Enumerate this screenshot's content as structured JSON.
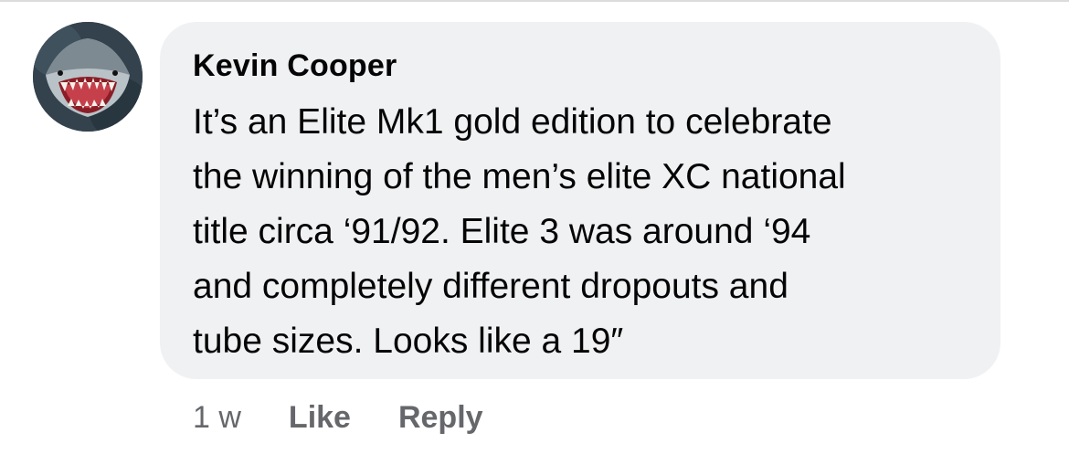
{
  "comment": {
    "author": "Kevin Cooper",
    "avatar_icon": "shark-avatar",
    "body_lines": [
      "It’s an Elite Mk1 gold edition to celebrate",
      "the winning of the men’s elite XC national",
      "title circa ‘91/92. Elite 3 was around ‘94",
      "and completely different dropouts and",
      "tube sizes. Looks like a 19″"
    ],
    "timestamp": "1 w",
    "like_label": "Like",
    "reply_label": "Reply"
  },
  "colors": {
    "bubble": "#f0f1f3",
    "text": "#050505",
    "secondary_text": "#65676b"
  }
}
